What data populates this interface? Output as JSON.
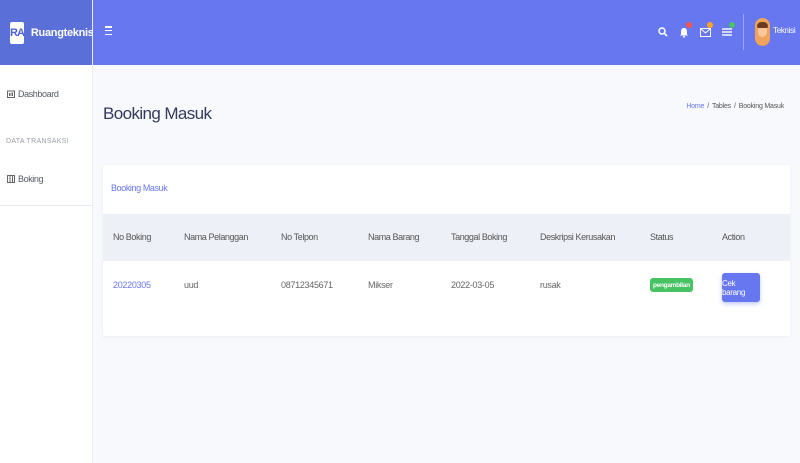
{
  "brand": {
    "logo_text": "RA",
    "name": "Ruangteknisi"
  },
  "sidebar": {
    "items": [
      {
        "label": "Dashboard",
        "icon": "dashboard-icon"
      },
      {
        "label": "Boking",
        "icon": "table-icon"
      }
    ],
    "heading": "DATA TRANSAKSI"
  },
  "topbar": {
    "icons": [
      "menu-icon",
      "search-icon",
      "bell-icon",
      "mail-icon",
      "list-icon"
    ],
    "badge_colors": {
      "bell": "#fc544b",
      "mail": "#ffa426",
      "list": "#47c363"
    },
    "user_name": "Teknisi"
  },
  "page": {
    "title": "Booking Masuk",
    "breadcrumb": [
      "Home",
      "Tables",
      "Booking Masuk"
    ]
  },
  "card": {
    "title": "Booking Masuk",
    "columns": [
      "No Boking",
      "Nama Pelanggan",
      "No Telpon",
      "Nama Barang",
      "Tanggal Boking",
      "Deskripsi Kerusakan",
      "Status",
      "Action"
    ],
    "rows": [
      {
        "no_boking": "20220305",
        "nama_pelanggan": "uud",
        "no_telpon": "08712345671",
        "nama_barang": "Mikser",
        "tanggal_boking": "2022-03-05",
        "deskripsi": "rusak",
        "status": "pengambilan",
        "action": "Cek barang"
      }
    ]
  },
  "colors": {
    "primary": "#6777ef",
    "success": "#47c363",
    "background": "#f8f9fc"
  }
}
